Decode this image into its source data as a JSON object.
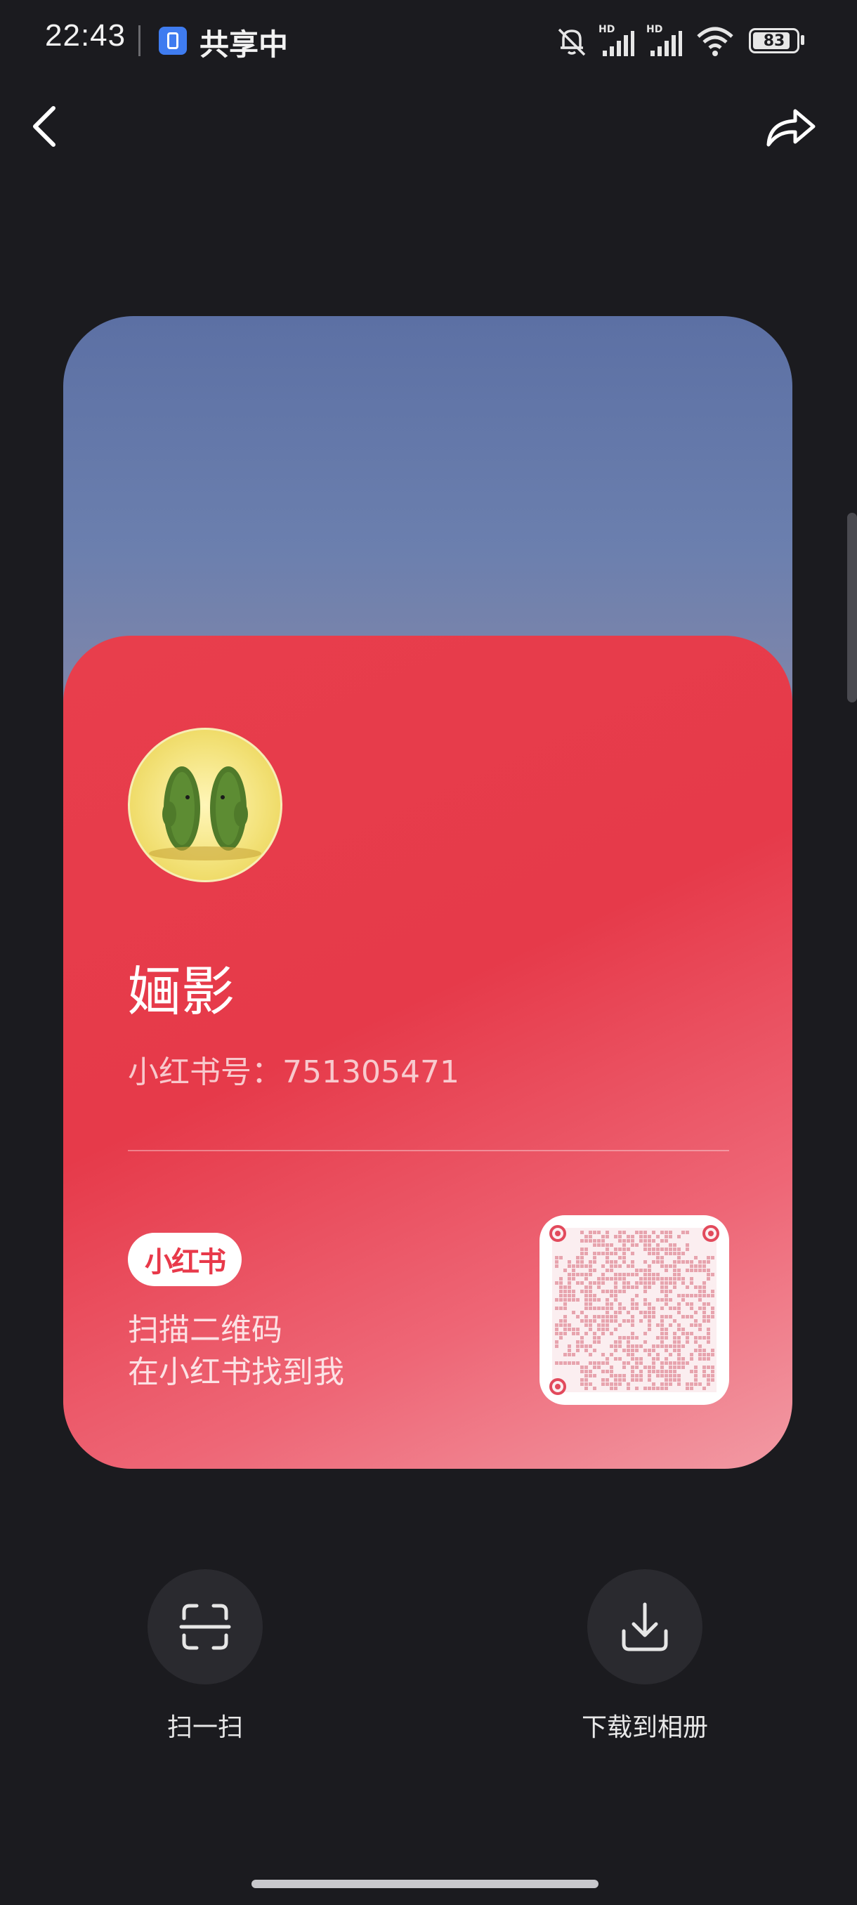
{
  "status_bar": {
    "time": "22:43",
    "sharing_label": "共享中",
    "battery": "83",
    "network_label_1": "HD",
    "network_label_2": "HD"
  },
  "nav": {
    "back_icon": "chevron-left-icon",
    "share_icon": "share-icon"
  },
  "card": {
    "name": "婳影",
    "id_text": "小红书号：751305471",
    "brand": "小红书",
    "hint_line1": "扫描二维码",
    "hint_line2": "在小红书找到我",
    "colors": {
      "card_red": "#e83e4c",
      "qr_pink": "#e7a4ae"
    }
  },
  "actions": [
    {
      "label": "扫一扫",
      "icon": "scan-icon"
    },
    {
      "label": "下载到相册",
      "icon": "download-icon"
    }
  ]
}
